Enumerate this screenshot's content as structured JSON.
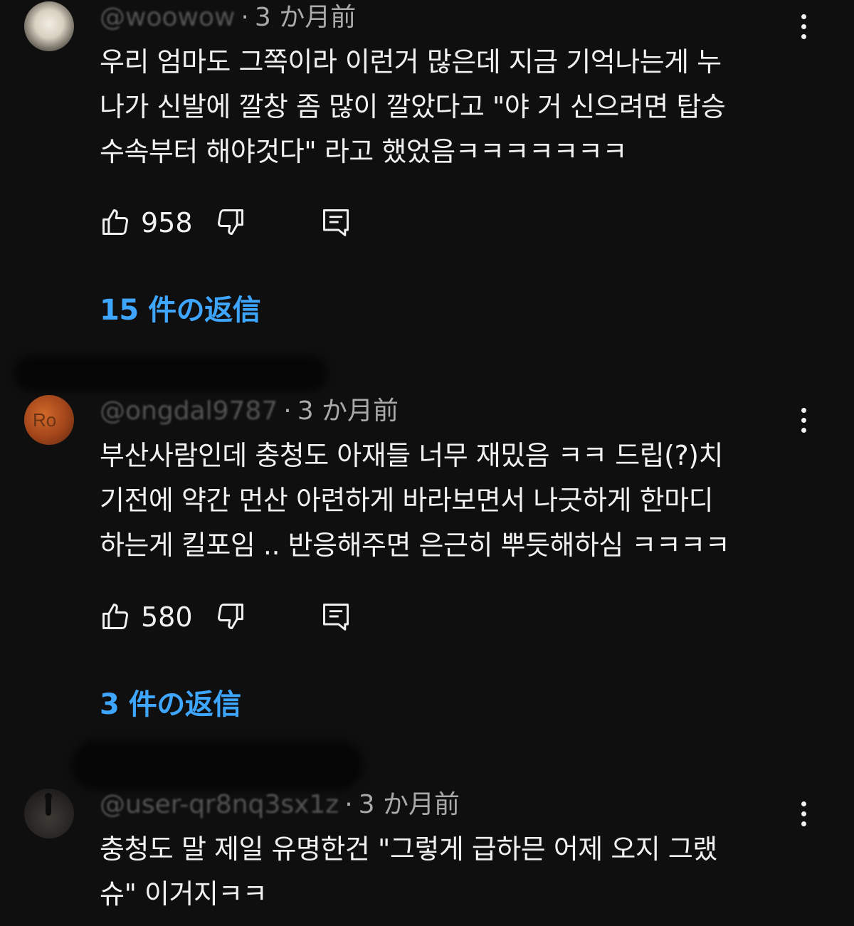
{
  "comments": [
    {
      "handle": "@woowow",
      "time": "3 か月前",
      "text": "우리 엄마도 그쪽이라 이런거 많은데 지금 기억나는게 누\n나가 신발에 깔창 좀 많이 깔았다고 \"야 거 신으려면 탑승\n수속부터 해야것다\" 라고 했었음ㅋㅋㅋㅋㅋㅋㅋ",
      "likes": "958",
      "replies": "15 件の返信"
    },
    {
      "handle": "@ongdal9787",
      "time": "3 か月前",
      "text": "부산사람인데 충청도 아재들 너무 재밌음 ㅋㅋ 드립(?)치\n기전에 약간 먼산 아련하게 바라보면서 나긋하게 한마디\n하는게 킬포임  .. 반응해주면 은근히 뿌듯해하심 ㅋㅋㅋㅋ",
      "likes": "580",
      "replies": "3 件の返信"
    },
    {
      "handle": "@user-qr8nq3sx1z",
      "time": "3 か月前",
      "text": "충청도 말 제일 유명한건 \"그렇게 급하믄 어제 오지 그랬\n슈\" 이거지ㅋㅋ"
    }
  ],
  "avatar_letters": "Ro",
  "colors": {
    "background": "#0f0f0f",
    "text": "#f1f1f1",
    "meta": "#aaaaaa",
    "link": "#3ea6ff"
  },
  "icons": [
    "thumbs-up-icon",
    "thumbs-down-icon",
    "reply-icon",
    "more-vert-icon"
  ]
}
